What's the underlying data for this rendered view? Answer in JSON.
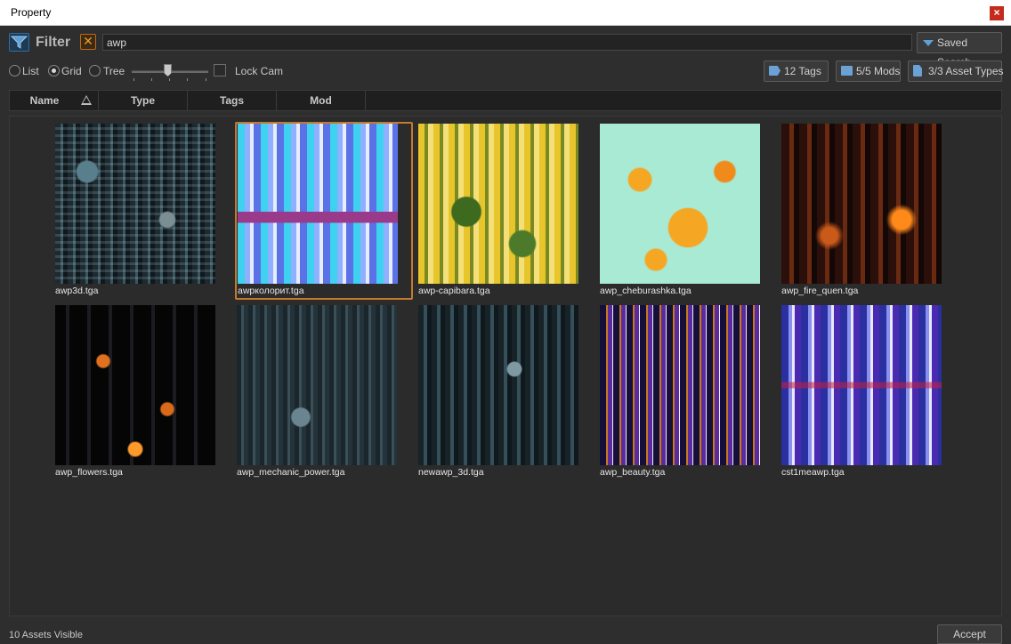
{
  "window": {
    "title": "Property",
    "close_label": "×"
  },
  "filter": {
    "label": "Filter",
    "clear_label": "✕",
    "query": "awp",
    "saved_search_label": "Saved Search"
  },
  "view": {
    "modes": [
      {
        "label": "List",
        "selected": false
      },
      {
        "label": "Grid",
        "selected": true
      },
      {
        "label": "Tree",
        "selected": false
      }
    ],
    "lock_cam_label": "Lock Cam",
    "lock_cam_checked": false,
    "tags_button": "12 Tags",
    "mods_button": "5/5 Mods",
    "types_button": "3/3 Asset Types"
  },
  "columns": [
    "Name",
    "Type",
    "Tags",
    "Mod"
  ],
  "assets": [
    {
      "name": "awp3d.tga",
      "selected": false
    },
    {
      "name": "awpколорит.tga",
      "selected": true
    },
    {
      "name": "awp-capibara.tga",
      "selected": false
    },
    {
      "name": "awp_cheburashka.tga",
      "selected": false
    },
    {
      "name": "awp_fire_quen.tga",
      "selected": false
    },
    {
      "name": "awp_flowers.tga",
      "selected": false
    },
    {
      "name": "awp_mechanic_power.tga",
      "selected": false
    },
    {
      "name": "newawp_3d.tga",
      "selected": false
    },
    {
      "name": "awp_beauty.tga",
      "selected": false
    },
    {
      "name": "cst1meawp.tga",
      "selected": false
    }
  ],
  "status": {
    "visible_count": "10 Assets Visible",
    "accept_label": "Accept"
  },
  "colors": {
    "selection_border": "#c47a2c",
    "accent_blue": "#5da0d8",
    "clear_orange": "#f39b1e"
  }
}
